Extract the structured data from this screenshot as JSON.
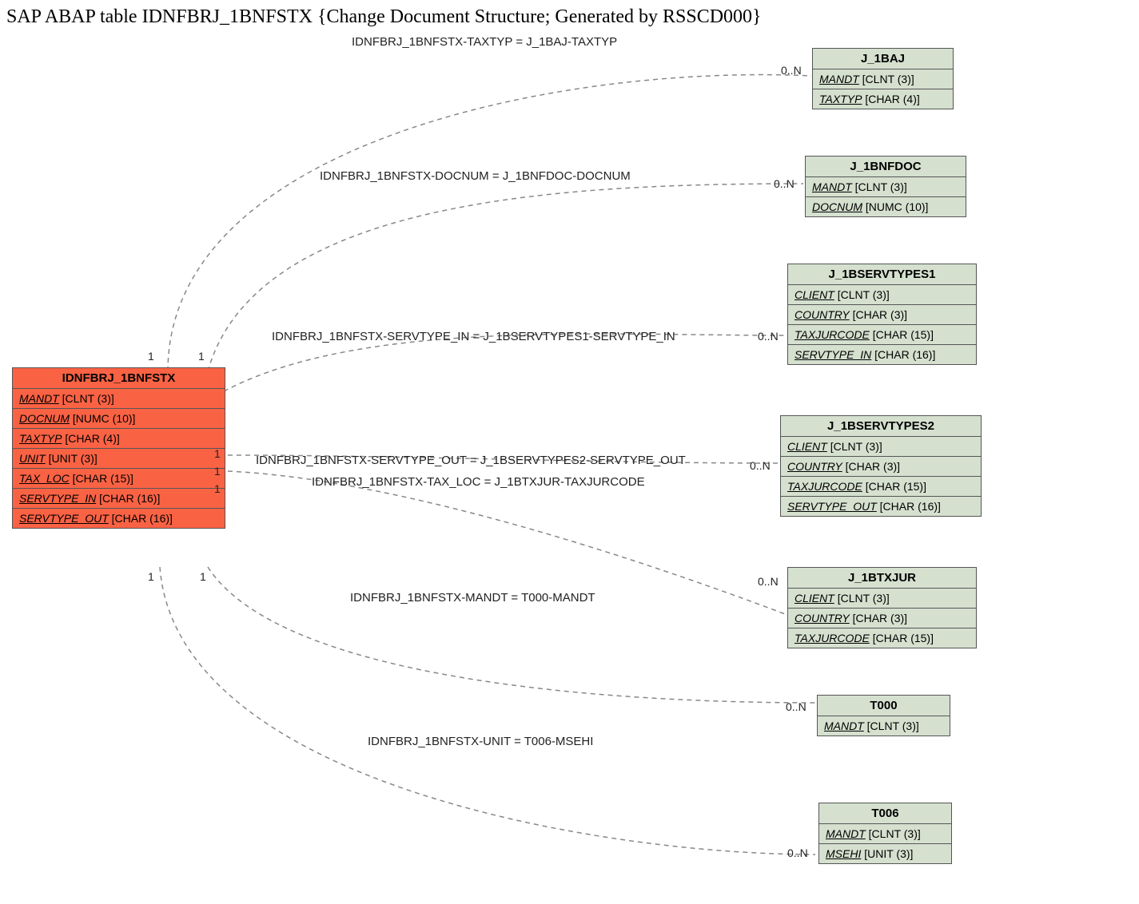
{
  "title": "SAP ABAP table IDNFBRJ_1BNFSTX {Change Document Structure; Generated by RSSCD000}",
  "main_entity": {
    "name": "IDNFBRJ_1BNFSTX",
    "fields": [
      {
        "name": "MANDT",
        "type": "[CLNT (3)]"
      },
      {
        "name": "DOCNUM",
        "type": "[NUMC (10)]"
      },
      {
        "name": "TAXTYP",
        "type": "[CHAR (4)]"
      },
      {
        "name": "UNIT",
        "type": "[UNIT (3)]"
      },
      {
        "name": "TAX_LOC",
        "type": "[CHAR (15)]"
      },
      {
        "name": "SERVTYPE_IN",
        "type": "[CHAR (16)]"
      },
      {
        "name": "SERVTYPE_OUT",
        "type": "[CHAR (16)]"
      }
    ]
  },
  "related": [
    {
      "name": "J_1BAJ",
      "fields": [
        {
          "name": "MANDT",
          "type": "[CLNT (3)]"
        },
        {
          "name": "TAXTYP",
          "type": "[CHAR (4)]"
        }
      ]
    },
    {
      "name": "J_1BNFDOC",
      "fields": [
        {
          "name": "MANDT",
          "type": "[CLNT (3)]"
        },
        {
          "name": "DOCNUM",
          "type": "[NUMC (10)]"
        }
      ]
    },
    {
      "name": "J_1BSERVTYPES1",
      "fields": [
        {
          "name": "CLIENT",
          "type": "[CLNT (3)]"
        },
        {
          "name": "COUNTRY",
          "type": "[CHAR (3)]"
        },
        {
          "name": "TAXJURCODE",
          "type": "[CHAR (15)]"
        },
        {
          "name": "SERVTYPE_IN",
          "type": "[CHAR (16)]"
        }
      ]
    },
    {
      "name": "J_1BSERVTYPES2",
      "fields": [
        {
          "name": "CLIENT",
          "type": "[CLNT (3)]"
        },
        {
          "name": "COUNTRY",
          "type": "[CHAR (3)]"
        },
        {
          "name": "TAXJURCODE",
          "type": "[CHAR (15)]"
        },
        {
          "name": "SERVTYPE_OUT",
          "type": "[CHAR (16)]"
        }
      ]
    },
    {
      "name": "J_1BTXJUR",
      "fields": [
        {
          "name": "CLIENT",
          "type": "[CLNT (3)]"
        },
        {
          "name": "COUNTRY",
          "type": "[CHAR (3)]"
        },
        {
          "name": "TAXJURCODE",
          "type": "[CHAR (15)]"
        }
      ]
    },
    {
      "name": "T000",
      "fields": [
        {
          "name": "MANDT",
          "type": "[CLNT (3)]"
        }
      ]
    },
    {
      "name": "T006",
      "fields": [
        {
          "name": "MANDT",
          "type": "[CLNT (3)]"
        },
        {
          "name": "MSEHI",
          "type": "[UNIT (3)]"
        }
      ]
    }
  ],
  "relations": [
    {
      "label": "IDNFBRJ_1BNFSTX-TAXTYP = J_1BAJ-TAXTYP",
      "card_left": "1",
      "card_right": "0..N"
    },
    {
      "label": "IDNFBRJ_1BNFSTX-DOCNUM = J_1BNFDOC-DOCNUM",
      "card_left": "1",
      "card_right": "0..N"
    },
    {
      "label": "IDNFBRJ_1BNFSTX-SERVTYPE_IN = J_1BSERVTYPES1-SERVTYPE_IN",
      "card_left": "",
      "card_right": "0..N"
    },
    {
      "label": "IDNFBRJ_1BNFSTX-SERVTYPE_OUT = J_1BSERVTYPES2-SERVTYPE_OUT",
      "card_left": "1",
      "card_right": "0..N"
    },
    {
      "label": "IDNFBRJ_1BNFSTX-TAX_LOC = J_1BTXJUR-TAXJURCODE",
      "card_left": "1",
      "card_right": ""
    },
    {
      "label": "IDNFBRJ_1BNFSTX-MANDT = T000-MANDT",
      "card_left": "1",
      "card_right": "0..N"
    },
    {
      "label": "IDNFBRJ_1BNFSTX-UNIT = T006-MSEHI",
      "card_left": "1",
      "card_right": "0..N"
    }
  ],
  "extra_cards": {
    "main_bottom_left_1": "1",
    "main_mid_1": "1",
    "j1btxjur_0n": "0..N"
  }
}
